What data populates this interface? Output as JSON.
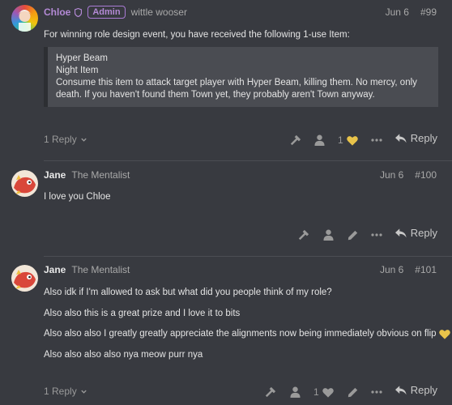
{
  "posts": [
    {
      "username": "Chloe",
      "badge": "Admin",
      "user_title": "wittle wooser",
      "date": "Jun 6",
      "number": "#99",
      "intro": "For winning role design event, you have received the following 1-use Item:",
      "quote_lines": [
        "Hyper Beam",
        "Night Item",
        "Consume this item to attack target player with Hyper Beam, killing them. No mercy, only death. If you haven't found them Town yet, they probably aren't Town anyway."
      ],
      "replies": "1 Reply",
      "likes": "1",
      "reply_label": "Reply"
    },
    {
      "username": "Jane",
      "user_title": "The Mentalist",
      "date": "Jun 6",
      "number": "#100",
      "paragraphs": [
        "I love you Chloe"
      ],
      "reply_label": "Reply"
    },
    {
      "username": "Jane",
      "user_title": "The Mentalist",
      "date": "Jun 6",
      "number": "#101",
      "paragraphs": [
        "Also idk if I'm allowed to ask but what did you people think of my role?",
        "Also also this is a great prize and I love it to bits",
        "Also also also I greatly greatly appreciate the alignments now being immediately obvious on flip",
        "Also also also also nya meow purr nya"
      ],
      "replies": "1 Reply",
      "likes": "1",
      "reply_label": "Reply"
    }
  ],
  "colors": {
    "background": "#383a40",
    "admin_purple": "#b48ad6",
    "heart_yellow": "#e8c34a"
  },
  "icons": [
    "shield-icon",
    "hammer-icon",
    "person-icon",
    "heart-icon",
    "ellipsis-icon",
    "reply-icon",
    "pencil-icon",
    "chevron-down-icon"
  ]
}
